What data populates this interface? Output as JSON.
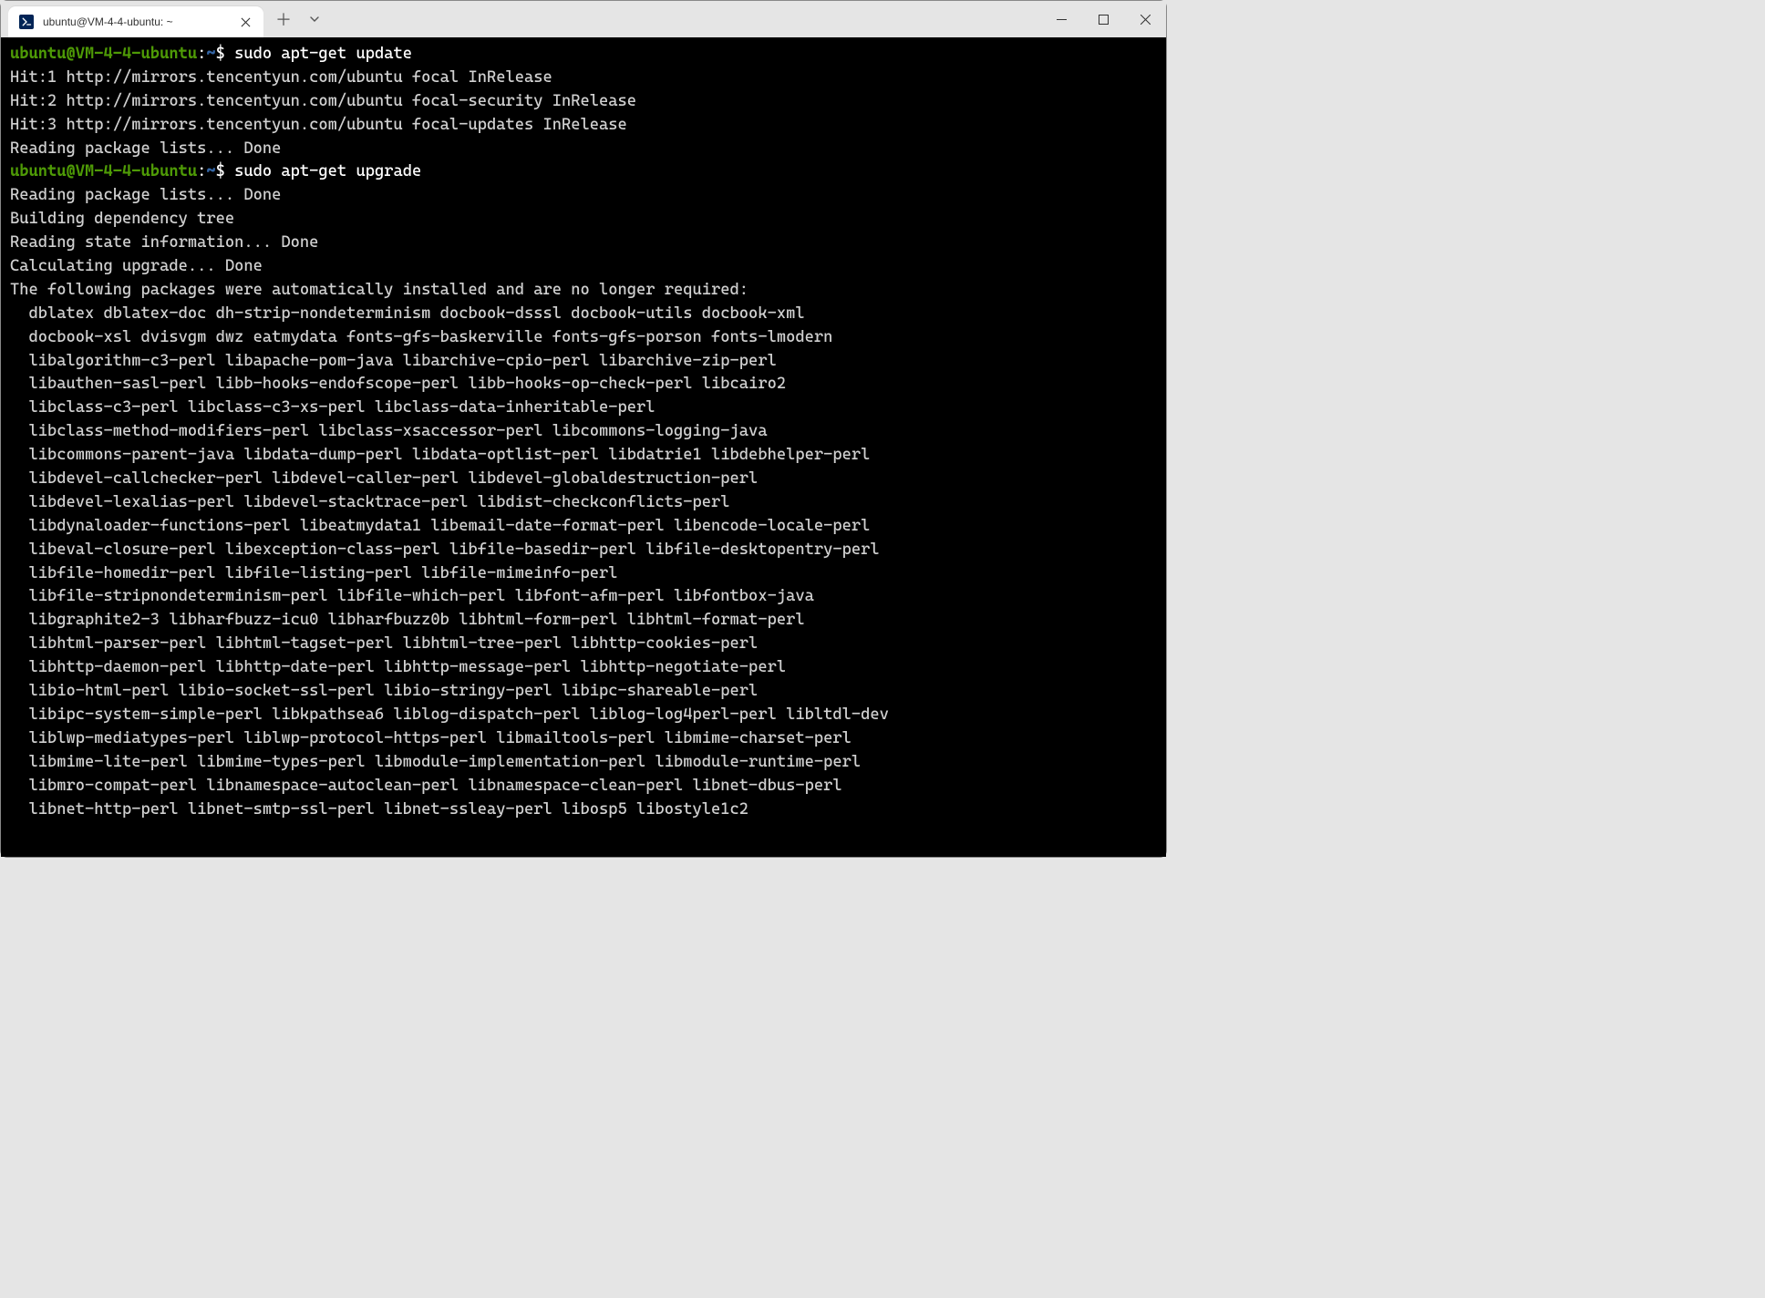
{
  "window": {
    "tab": {
      "title": "ubuntu@VM-4-4-ubuntu: ~"
    }
  },
  "terminal": {
    "prompt": {
      "user_host": "ubuntu@VM-4-4-ubuntu",
      "path": "~",
      "symbol": "$"
    },
    "commands": [
      "sudo apt-get update",
      "sudo apt-get upgrade"
    ],
    "output_update": [
      "Hit:1 http://mirrors.tencentyun.com/ubuntu focal InRelease",
      "Hit:2 http://mirrors.tencentyun.com/ubuntu focal-security InRelease",
      "Hit:3 http://mirrors.tencentyun.com/ubuntu focal-updates InRelease",
      "Reading package lists... Done"
    ],
    "output_upgrade_header": [
      "Reading package lists... Done",
      "Building dependency tree",
      "Reading state information... Done",
      "Calculating upgrade... Done",
      "The following packages were automatically installed and are no longer required:"
    ],
    "output_packages": [
      "  dblatex dblatex-doc dh-strip-nondeterminism docbook-dsssl docbook-utils docbook-xml",
      "  docbook-xsl dvisvgm dwz eatmydata fonts-gfs-baskerville fonts-gfs-porson fonts-lmodern",
      "  libalgorithm-c3-perl libapache-pom-java libarchive-cpio-perl libarchive-zip-perl",
      "  libauthen-sasl-perl libb-hooks-endofscope-perl libb-hooks-op-check-perl libcairo2",
      "  libclass-c3-perl libclass-c3-xs-perl libclass-data-inheritable-perl",
      "  libclass-method-modifiers-perl libclass-xsaccessor-perl libcommons-logging-java",
      "  libcommons-parent-java libdata-dump-perl libdata-optlist-perl libdatrie1 libdebhelper-perl",
      "  libdevel-callchecker-perl libdevel-caller-perl libdevel-globaldestruction-perl",
      "  libdevel-lexalias-perl libdevel-stacktrace-perl libdist-checkconflicts-perl",
      "  libdynaloader-functions-perl libeatmydata1 libemail-date-format-perl libencode-locale-perl",
      "  libeval-closure-perl libexception-class-perl libfile-basedir-perl libfile-desktopentry-perl",
      "  libfile-homedir-perl libfile-listing-perl libfile-mimeinfo-perl",
      "  libfile-stripnondeterminism-perl libfile-which-perl libfont-afm-perl libfontbox-java",
      "  libgraphite2-3 libharfbuzz-icu0 libharfbuzz0b libhtml-form-perl libhtml-format-perl",
      "  libhtml-parser-perl libhtml-tagset-perl libhtml-tree-perl libhttp-cookies-perl",
      "  libhttp-daemon-perl libhttp-date-perl libhttp-message-perl libhttp-negotiate-perl",
      "  libio-html-perl libio-socket-ssl-perl libio-stringy-perl libipc-shareable-perl",
      "  libipc-system-simple-perl libkpathsea6 liblog-dispatch-perl liblog-log4perl-perl libltdl-dev",
      "  liblwp-mediatypes-perl liblwp-protocol-https-perl libmailtools-perl libmime-charset-perl",
      "  libmime-lite-perl libmime-types-perl libmodule-implementation-perl libmodule-runtime-perl",
      "  libmro-compat-perl libnamespace-autoclean-perl libnamespace-clean-perl libnet-dbus-perl",
      "  libnet-http-perl libnet-smtp-ssl-perl libnet-ssleay-perl libosp5 libostyle1c2"
    ]
  }
}
